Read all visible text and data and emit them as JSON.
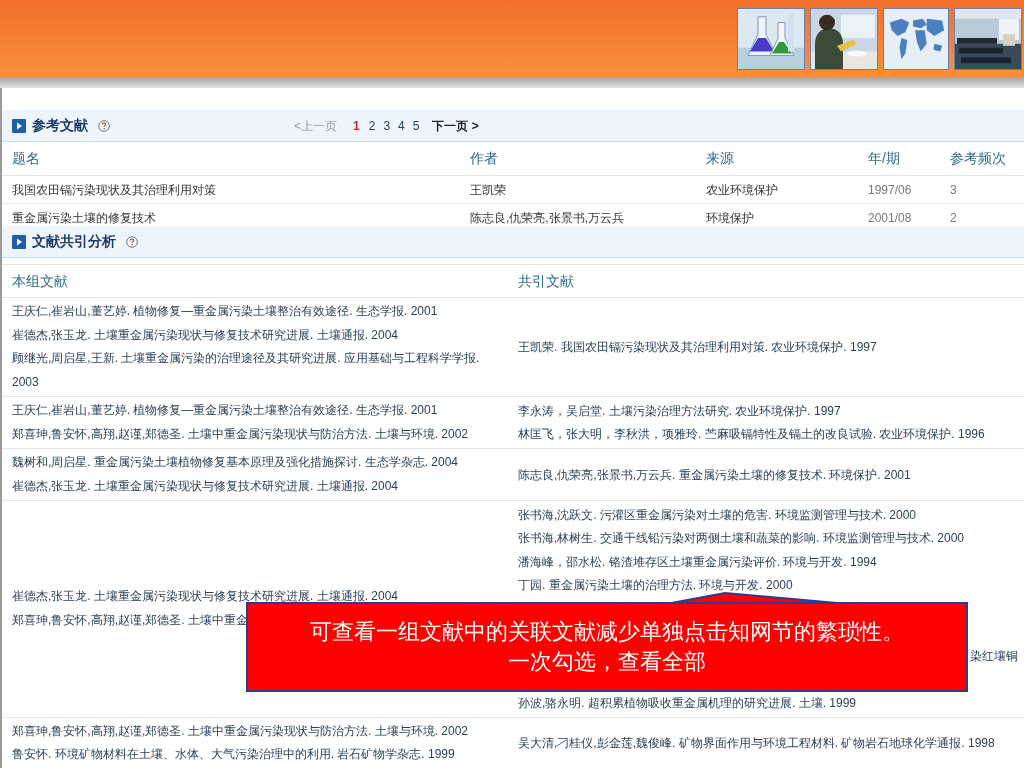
{
  "references": {
    "title": "参考文献",
    "pager": {
      "prev": {
        "label": "<上一页",
        "disabled": true
      },
      "pages": [
        {
          "label": "1",
          "selected": true
        },
        {
          "label": "2",
          "selected": false
        },
        {
          "label": "3",
          "selected": false
        },
        {
          "label": "4",
          "selected": false
        },
        {
          "label": "5",
          "selected": false
        }
      ],
      "next": {
        "label": "下一页 >",
        "disabled": false
      }
    },
    "columns": [
      "题名",
      "作者",
      "来源",
      "年/期",
      "参考频次"
    ],
    "rows": [
      [
        "我国农田镉污染现状及其治理利用对策",
        "王凯荣",
        "农业环境保护",
        "1997/06",
        "3"
      ],
      [
        "重金属污染土壤的修复技术",
        "陈志良,仇荣亮,张景书,万云兵",
        "环境保护",
        "2001/08",
        "2"
      ]
    ]
  },
  "cocitation": {
    "title": "文献共引分析",
    "columns": [
      "本组文献",
      "共引文献"
    ],
    "rows": [
      {
        "group": [
          "王庆仁,崔岩山,董艺婷. 植物修复—重金属污染土壤整治有效途径. 生态学报. 2001",
          "崔德杰,张玉龙. 土壤重金属污染现状与修复技术研究进展. 土壤通报. 2004",
          "顾继光,周启星,王新. 土壤重金属污染的治理途径及其研究进展. 应用基础与工程科学学报. 2003"
        ],
        "cited": [
          {
            "text": "王凯荣. 我国农田镉污染现状及其治理利用对策. 农业环境保护. 1997",
            "kind": "line"
          }
        ]
      },
      {
        "group": [
          "王庆仁,崔岩山,董艺婷. 植物修复—重金属污染土壤整治有效途径. 生态学报. 2001",
          "郑喜珅,鲁安怀,高翔,赵谨,郑德圣. 土壤中重金属污染现状与防治方法. 土壤与环境. 2002"
        ],
        "cited": [
          {
            "text": "李永涛，吴启堂. 土壤污染治理方法研究. 农业环境保护. 1997",
            "kind": "line"
          },
          {
            "text": "林匡飞，张大明，李秋洪，项雅玲. 苎麻吸镉特性及镉土的改良试验. 农业环境保护. 1996",
            "kind": "line"
          }
        ]
      },
      {
        "group": [
          "魏树和,周启星. 重金属污染土壤植物修复基本原理及强化措施探讨. 生态学杂志. 2004",
          "崔德杰,张玉龙. 土壤重金属污染现状与修复技术研究进展. 土壤通报. 2004"
        ],
        "cited": [
          {
            "text": "陈志良,仇荣亮,张景书,万云兵. 重金属污染土壤的修复技术. 环境保护. 2001",
            "kind": "line"
          }
        ]
      },
      {
        "group": [
          "崔德杰,张玉龙. 土壤重金属污染现状与修复技术研究进展. 土壤通报. 2004",
          "郑喜珅,鲁安怀,高翔,赵谨,郑德圣. 土壤中重金"
        ],
        "cited": [
          {
            "text": "张书海,沈跃文. 污灌区重金属污染对土壤的危害. 环境监测管理与技术. 2000",
            "kind": "line"
          },
          {
            "text": "张书海,林树生. 交通干线铅污染对两侧土壤和蔬菜的影响. 环境监测管理与技术. 2000",
            "kind": "line"
          },
          {
            "text": "潘海峰，邵水松. 铬渣堆存区土壤重金属污染评价. 环境与开发. 1994",
            "kind": "line"
          },
          {
            "text": "丁园. 重金属污染土壤的治理方法. 环境与开发. 2000",
            "kind": "line"
          },
          {
            "text": "染红壤铜",
            "kind": "partial"
          },
          {
            "text": "孙波,骆永明. 超积累植物吸收重金属机理的研究进展. 土壤. 1999",
            "kind": "line"
          }
        ]
      },
      {
        "group": [
          "郑喜珅,鲁安怀,高翔,赵谨,郑德圣. 土壤中重金属污染现状与防治方法. 土壤与环境. 2002",
          "鲁安怀. 环境矿物材料在土壤、水体、大气污染治理中的利用. 岩石矿物学杂志. 1999"
        ],
        "cited": [
          {
            "text": "吴大清,刁桂仪,彭金莲,魏俊峰. 矿物界面作用与环境工程材料. 矿物岩石地球化学通报. 1998",
            "kind": "line"
          }
        ]
      }
    ]
  },
  "callout": {
    "lines": [
      "可查看一组文献中的关联文献减少单独点击知网节的繁琐性。",
      "一次勾选，查看全部"
    ]
  }
}
